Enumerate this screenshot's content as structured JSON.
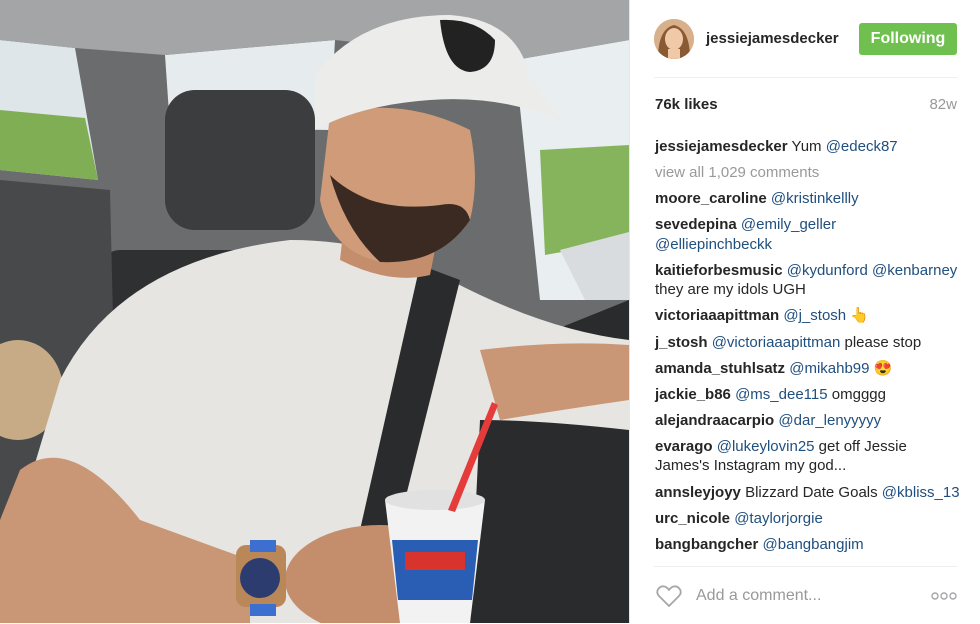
{
  "post": {
    "username": "jessiejamesdecker",
    "follow_label": "Following",
    "likes": "76k likes",
    "time": "82w",
    "caption": {
      "user": "jessiejamesdecker",
      "text": "Yum ",
      "mention": "@edeck87"
    },
    "view_all": "view all 1,029 comments",
    "add_comment_placeholder": "Add a comment...",
    "icons": {
      "like": "heart-outline-icon",
      "more": "more-options-icon"
    },
    "colors": {
      "follow_button": "#70c050",
      "mention": "#1f4f7e",
      "muted": "#999999"
    }
  },
  "comments": [
    {
      "user": "moore_caroline",
      "mention1": "@kristinkellly"
    },
    {
      "user": "sevedepina",
      "mention1": "@emily_geller",
      "mention2": "@elliepinchbeckk"
    },
    {
      "user": "kaitieforbesmusic",
      "mention1": "@kydunford",
      "mention2": "@kenbarney",
      "text": "they are my idols UGH"
    },
    {
      "user": "victoriaaapittman",
      "mention1": "@j_stosh",
      "emoji": "👆"
    },
    {
      "user": "j_stosh",
      "mention1": "@victoriaaapittman",
      "text": "please stop"
    },
    {
      "user": "amanda_stuhlsatz",
      "mention1": "@mikahb99",
      "emoji": "😍"
    },
    {
      "user": "jackie_b86",
      "mention1": "@ms_dee115",
      "text": "omgggg"
    },
    {
      "user": "alejandraacarpio",
      "mention1": "@dar_lenyyyyy"
    },
    {
      "user": "evarago",
      "mention1": "@lukeylovin25",
      "text": "get off Jessie James's Instagram my god..."
    },
    {
      "user": "annsleyjoyy",
      "text": "Blizzard Date Goals",
      "mention1": "@kbliss_13"
    },
    {
      "user": "urc_nicole",
      "mention1": "@taylorjorgie"
    },
    {
      "user": "bangbangcher",
      "mention1": "@bangbangjim"
    }
  ]
}
